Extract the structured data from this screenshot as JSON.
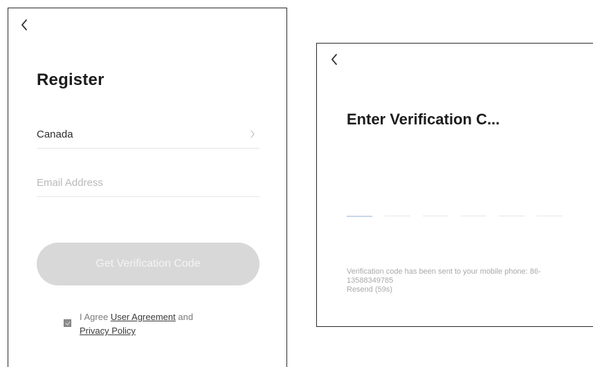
{
  "register": {
    "title": "Register",
    "country": "Canada",
    "email_placeholder": "Email Address",
    "get_code_label": "Get Verification Code",
    "agree_prefix": "I Agree ",
    "user_agreement": "User Agreement",
    "agree_and": " and",
    "privacy_policy": "Privacy Policy"
  },
  "verification": {
    "title": "Enter Verification C...",
    "code_length": 6,
    "message": "Verification code has been sent to your mobile phone: 86-13588349785",
    "resend_label": "Resend (59s)"
  },
  "colors": {
    "button_disabled_bg": "#d8d8d8",
    "active_slot": "#c9d6e6"
  },
  "icons": {
    "back": "chevron-left-icon",
    "country_chevron": "chevron-right-icon"
  }
}
